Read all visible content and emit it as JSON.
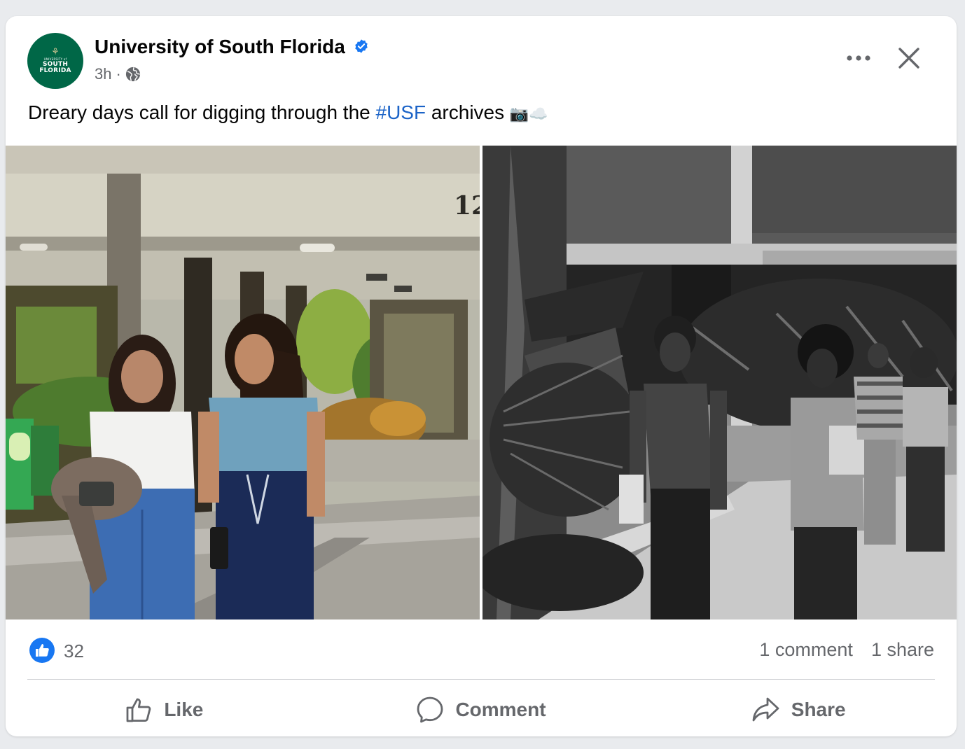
{
  "page": {
    "name": "University of South Florida",
    "avatar": {
      "university_text": "UNIVERSITY of",
      "line1": "SOUTH",
      "line2": "FLORIDA",
      "bull_glyph": "⚘",
      "color": "#006747",
      "accent": "#cfc493"
    },
    "verified_icon": "verified-badge-icon",
    "time": "3h",
    "separator": "·",
    "audience_icon": "globe-icon"
  },
  "post": {
    "caption_before": "Dreary days call for digging through the ",
    "hashtag": "#USF",
    "caption_after": " archives ",
    "emoji": "📷☁️",
    "hashtag_color": "#1b63c7"
  },
  "header_actions": {
    "more_icon": "more-horizontal-icon",
    "close_icon": "close-icon"
  },
  "photos": [
    {
      "type": "color-photo"
    },
    {
      "type": "black-and-white-photo",
      "building_number": "12"
    }
  ],
  "reactions": {
    "count": "32",
    "icon": "like-reaction-icon",
    "color": "#1877f2"
  },
  "engagement": {
    "comments": "1 comment",
    "shares": "1 share"
  },
  "actions": {
    "like": "Like",
    "comment": "Comment",
    "share": "Share"
  }
}
